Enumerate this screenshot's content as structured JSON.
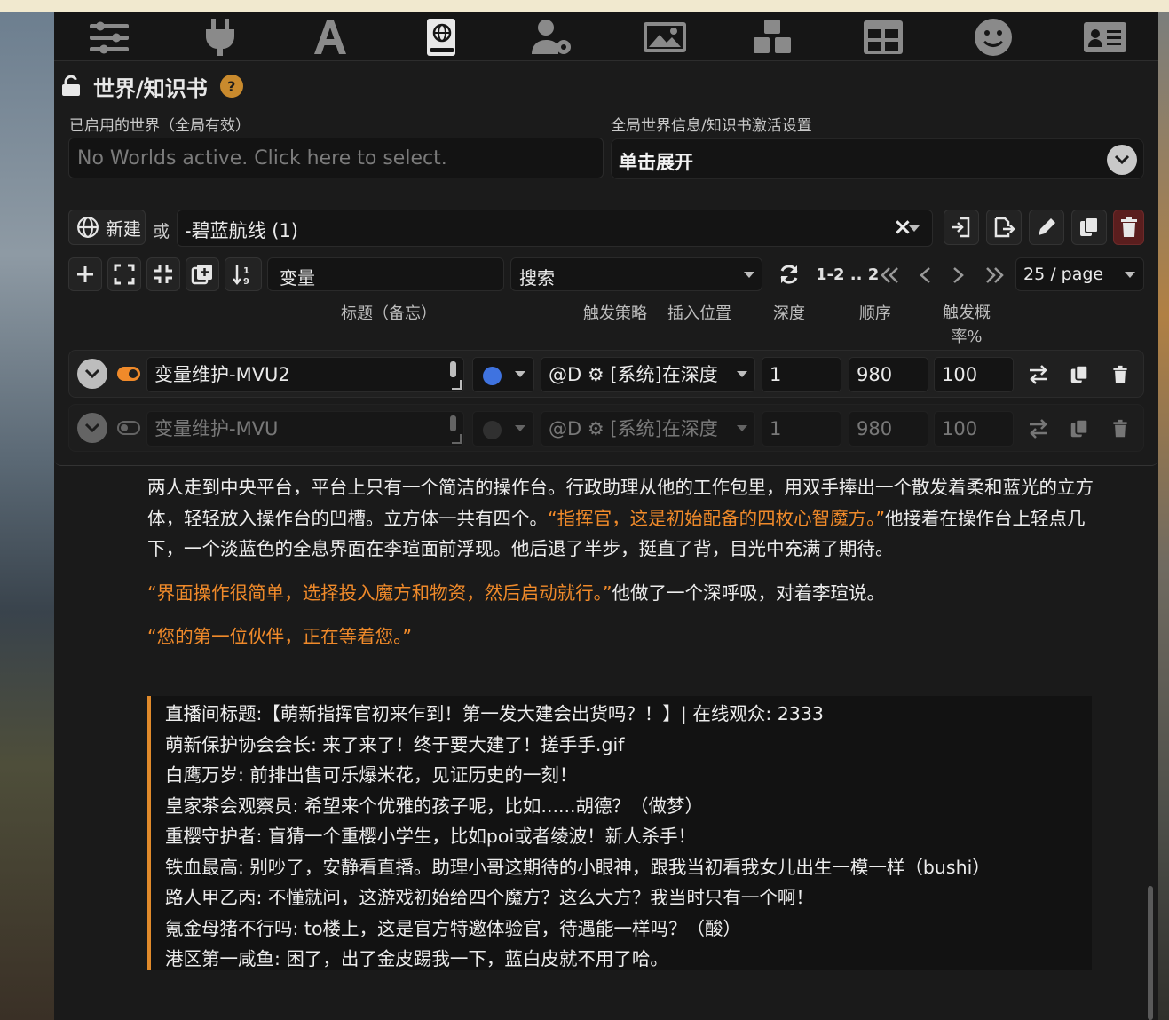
{
  "nav": {
    "icons": [
      "sliders-icon",
      "plug-icon",
      "font-icon",
      "book-globe-icon",
      "user-gear-icon",
      "image-icon",
      "cubes-icon",
      "grid-icon",
      "smile-icon",
      "id-card-icon"
    ]
  },
  "panel": {
    "title": "世界/知识书",
    "help": "?",
    "active_worlds_label": "已启用的世界（全局有效）",
    "active_worlds_placeholder": "No Worlds active. Click here to select.",
    "global_settings_label": "全局世界信息/知识书激活设置",
    "global_settings_toggle": "单击展开"
  },
  "editor": {
    "new_label": "新建",
    "or_label": "或",
    "selected_book": "-碧蓝航线 (1)",
    "clear_glyph": "×"
  },
  "filter": {
    "search_value": "变量",
    "sort_value": "搜索",
    "page_info": "1-2 .. 2",
    "per_page": "25 / page"
  },
  "columns": {
    "title": "标题（备忘）",
    "strategy": "触发策略",
    "position": "插入位置",
    "depth": "深度",
    "order": "顺序",
    "probability": "触发概率%"
  },
  "entries": [
    {
      "enabled": true,
      "title": "变量维护-MVU2",
      "strategy_color": "#3f73e0",
      "position": "@D ⚙ [系统]在深度",
      "depth": "1",
      "order": "980",
      "probability": "100"
    },
    {
      "enabled": false,
      "title": "变量维护-MVU",
      "strategy_color": "#4a4a4a",
      "position": "@D ⚙ [系统]在深度",
      "depth": "1",
      "order": "980",
      "probability": "100"
    }
  ],
  "chat": {
    "p1_a": "两人走到中央平台，平台上只有一个简洁的操作台。行政助理从他的工作包里，用双手捧出一个散发着柔和蓝光的立方体，轻轻放入操作台的凹槽。立方体一共有四个。",
    "p1_b": "“指挥官，这是初始配备的四枚心智魔方。”",
    "p1_c": "他接着在操作台上轻点几下，一个淡蓝色的全息界面在李瑄面前浮现。他后退了半步，挺直了背，目光中充满了期待。",
    "p2_a": "“界面操作很简单，选择投入魔方和物资，然后启动就行。”",
    "p2_b": "他做了一个深呼吸，对着李瑄说。",
    "p3": "“您的第一位伙伴，正在等着您。”",
    "comments": [
      "直播间标题:【萌新指挥官初来乍到！第一发大建会出货吗？！】| 在线观众: 2333",
      "萌新保护协会会长: 来了来了！终于要大建了！搓手手.gif",
      "白鹰万岁: 前排出售可乐爆米花，见证历史的一刻！",
      "皇家茶会观察员: 希望来个优雅的孩子呢，比如......胡德？（做梦）",
      "重樱守护者: 盲猜一个重樱小学生，比如poi或者绫波！新人杀手！",
      "铁血最高: 别吵了，安静看直播。助理小哥这期待的小眼神，跟我当初看我女儿出生一模一样（bushi）",
      "路人甲乙丙: 不懂就问，这游戏初始给四个魔方？这么大方？我当时只有一个啊！",
      "氪金母猪不行吗: to楼上，这是官方特邀体验官，待遇能一样吗？（酸）",
      "港区第一咸鱼: 困了，出了金皮踢我一下，蓝白皮就不用了哈。"
    ]
  },
  "colors": {
    "accent": "#f08a2a",
    "help_badge": "#c98a2d",
    "delete_bg": "#5a1e1e"
  }
}
